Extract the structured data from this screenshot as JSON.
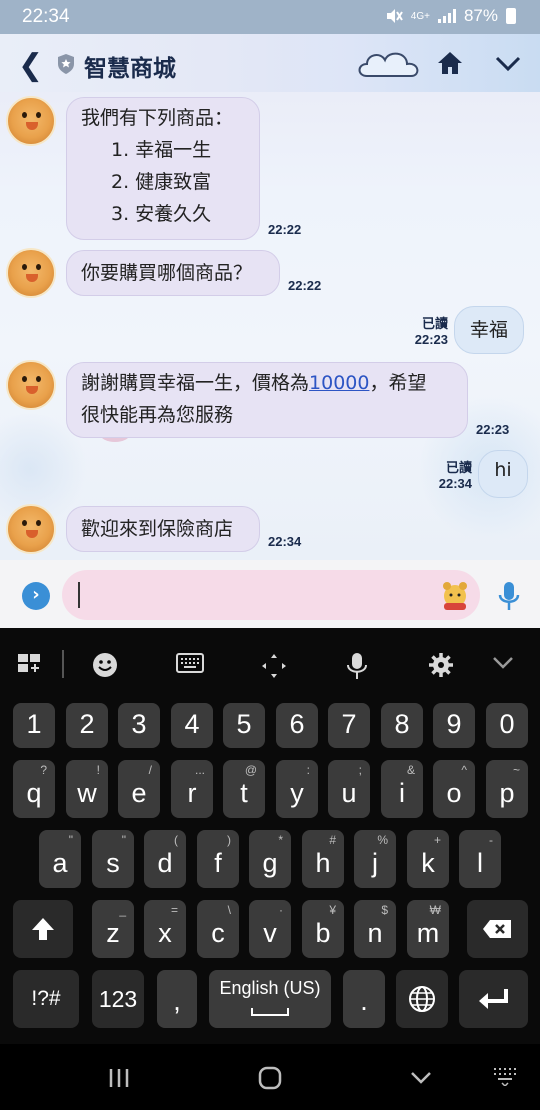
{
  "status_bar": {
    "time": "22:34",
    "network": "4G+",
    "battery": "87%"
  },
  "header": {
    "title": "智慧商城"
  },
  "messages": [
    {
      "side": "in",
      "lines": [
        "我們有下列商品：",
        "1. 幸福一生",
        "2. 健康致富",
        "3. 安養久久"
      ],
      "time": "22:22"
    },
    {
      "side": "in",
      "text": "你要購買哪個商品？",
      "time": "22:22"
    },
    {
      "side": "out",
      "text": "幸福",
      "read": "已讀",
      "time": "22:23"
    },
    {
      "side": "in",
      "text_before": "謝謝購買幸福一生，價格為",
      "link": "10000",
      "text_after": "，希望",
      "line2": "很快能再為您服務",
      "time": "22:23"
    },
    {
      "side": "out",
      "text": "hi",
      "read": "已讀",
      "time": "22:34"
    },
    {
      "side": "in",
      "text": "歡迎來到保險商店",
      "time": "22:34"
    }
  ],
  "input": {
    "value": ""
  },
  "keyboard": {
    "row_numbers": [
      "1",
      "2",
      "3",
      "4",
      "5",
      "6",
      "7",
      "8",
      "9",
      "0"
    ],
    "row1": [
      [
        "q",
        "?"
      ],
      [
        "w",
        "!"
      ],
      [
        "e",
        "/"
      ],
      [
        "r",
        "..."
      ],
      [
        "t",
        "@"
      ],
      [
        "y",
        ":"
      ],
      [
        "u",
        ";"
      ],
      [
        "i",
        "&"
      ],
      [
        "o",
        "^"
      ],
      [
        "p",
        "~"
      ]
    ],
    "row2": [
      [
        "a",
        "\""
      ],
      [
        "s",
        "\""
      ],
      [
        "d",
        "("
      ],
      [
        "f",
        ")"
      ],
      [
        "g",
        "*"
      ],
      [
        "h",
        "#"
      ],
      [
        "j",
        "%"
      ],
      [
        "k",
        "+"
      ],
      [
        "l",
        "-"
      ]
    ],
    "row3": [
      [
        "z",
        "_"
      ],
      [
        "x",
        "="
      ],
      [
        "c",
        "\\"
      ],
      [
        "v",
        "·"
      ],
      [
        "b",
        "¥"
      ],
      [
        "n",
        "$"
      ],
      [
        "m",
        "₩"
      ]
    ],
    "symbols_label": "!?#",
    "numbers_label": "123",
    "comma": ",",
    "space_label": "English (US)",
    "period": "."
  }
}
